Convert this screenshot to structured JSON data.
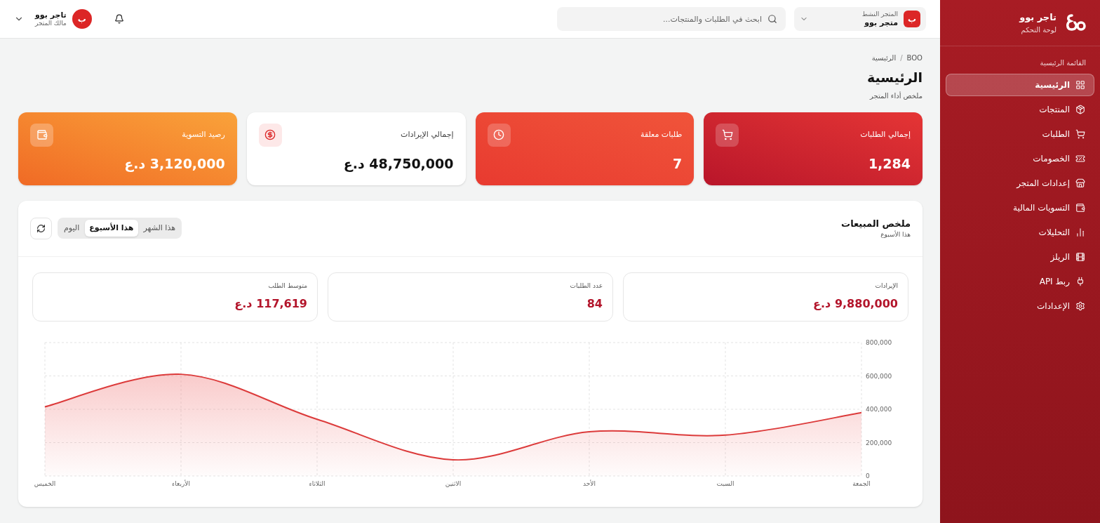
{
  "sidebar": {
    "brand": "تاجر بوو",
    "subtitle": "لوحة التحكم",
    "section": "القائمة الرئيسية",
    "items": [
      {
        "label": "الرئيسية",
        "selected": true
      },
      {
        "label": "المنتجات",
        "selected": false
      },
      {
        "label": "الطلبات",
        "selected": false
      },
      {
        "label": "الخصومات",
        "selected": false
      },
      {
        "label": "إعدادات المتجر",
        "selected": false
      },
      {
        "label": "التسويات المالية",
        "selected": false
      },
      {
        "label": "التحليلات",
        "selected": false
      },
      {
        "label": "الريلز",
        "selected": false
      },
      {
        "label": "ربط API",
        "selected": false
      },
      {
        "label": "الإعدادات",
        "selected": false
      }
    ]
  },
  "topbar": {
    "store": {
      "badge": "ب",
      "caption": "المتجر النشط",
      "name": "متجر بوو"
    },
    "search": {
      "placeholder": "ابحث في الطلبات والمنتجات..."
    },
    "user": {
      "avatar": "ب",
      "name": "تاجر بوو",
      "role": "مالك المتجر"
    }
  },
  "breadcrumb": {
    "items": [
      "BOO",
      "الرئيسية"
    ],
    "separator": "/"
  },
  "page": {
    "title": "الرئيسية",
    "subtitle": "ملخص أداء المتجر"
  },
  "stats": [
    {
      "label": "إجمالي الطلبات",
      "value": "1,284",
      "kind": "red"
    },
    {
      "label": "طلبات معلقة",
      "value": "7",
      "kind": "orange-red"
    },
    {
      "label": "إجمالي الإيرادات",
      "value": "48,750,000 د.ع",
      "kind": "white"
    },
    {
      "label": "رصيد التسوية",
      "value": "3,120,000 د.ع",
      "kind": "orange"
    }
  ],
  "sales": {
    "title": "ملخص المبيعات",
    "subtitle": "هذا الأسبوع",
    "tabs": [
      {
        "label": "هذا الشهر",
        "selected": false
      },
      {
        "label": "هذا الأسبوع",
        "selected": true
      },
      {
        "label": "اليوم",
        "selected": false
      }
    ],
    "metrics": [
      {
        "label": "الإيرادات",
        "value": "9,880,000 د.ع"
      },
      {
        "label": "عدد الطلبات",
        "value": "84"
      },
      {
        "label": "متوسط الطلب",
        "value": "117,619 د.ع"
      }
    ],
    "chart_data": {
      "type": "area",
      "grid": true,
      "categories": [
        "الخميس",
        "الأربعاء",
        "الثلاثاء",
        "الاثنين",
        "الأحد",
        "السبت",
        "الجمعة"
      ],
      "series": [
        {
          "color": "#dc3b3b",
          "values": [
            415000,
            610000,
            340000,
            97000,
            265000,
            245000,
            380000
          ]
        }
      ],
      "ylim": [
        0,
        800000
      ],
      "yticks": [
        {
          "value": 0,
          "label": "0"
        },
        {
          "value": 200000,
          "label": "200,000"
        },
        {
          "value": 400000,
          "label": "400,000"
        },
        {
          "value": 600000,
          "label": "600,000"
        },
        {
          "value": 800000,
          "label": "800,000"
        }
      ]
    }
  }
}
